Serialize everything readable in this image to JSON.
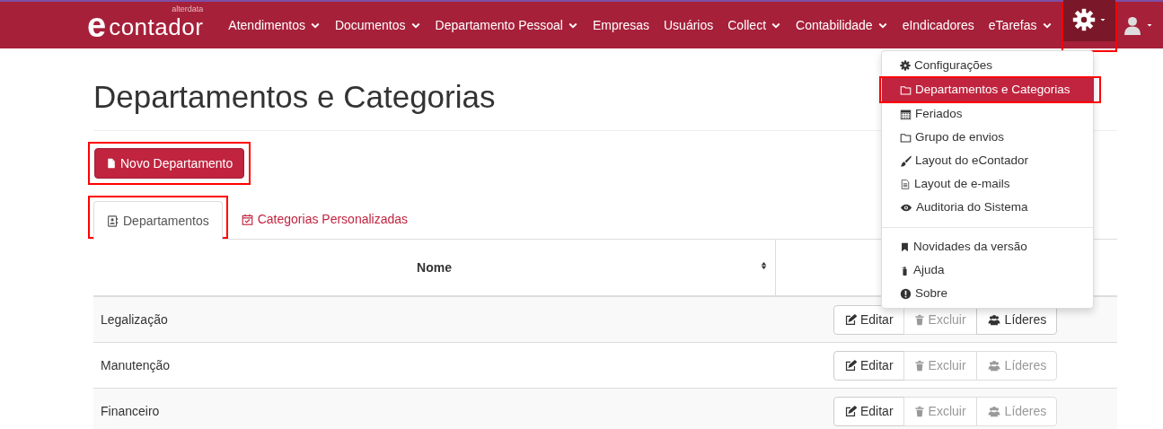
{
  "navbar": {
    "logo": {
      "mark": "e",
      "name": "contador",
      "brand": "alterdata"
    },
    "items": [
      {
        "label": "Atendimentos",
        "has_caret": true
      },
      {
        "label": "Documentos",
        "has_caret": true
      },
      {
        "label": "Departamento Pessoal",
        "has_caret": true
      },
      {
        "label": "Empresas",
        "has_caret": false
      },
      {
        "label": "Usuários",
        "has_caret": false
      },
      {
        "label": "Collect",
        "has_caret": true
      },
      {
        "label": "Contabilidade",
        "has_caret": true
      },
      {
        "label": "eIndicadores",
        "has_caret": false
      },
      {
        "label": "eTarefas",
        "has_caret": true
      }
    ],
    "settings": {
      "expanded": true,
      "highlighted": true
    }
  },
  "settings_menu": [
    {
      "kind": "item",
      "label": "Configurações",
      "selected": false,
      "highlighted": false
    },
    {
      "kind": "item",
      "label": "Departamentos e Categorias",
      "selected": true,
      "highlighted": true
    },
    {
      "kind": "item",
      "label": "Feriados",
      "selected": false,
      "highlighted": false
    },
    {
      "kind": "item",
      "label": "Grupo de envios",
      "selected": false,
      "highlighted": false
    },
    {
      "kind": "item",
      "label": "Layout do eContador",
      "selected": false,
      "highlighted": false
    },
    {
      "kind": "item",
      "label": "Layout de e-mails",
      "selected": false,
      "highlighted": false
    },
    {
      "kind": "item",
      "label": "Auditoria do Sistema",
      "selected": false,
      "highlighted": false
    },
    {
      "kind": "divider"
    },
    {
      "kind": "item",
      "label": "Novidades da versão",
      "selected": false,
      "highlighted": false
    },
    {
      "kind": "item",
      "label": "Ajuda",
      "selected": false,
      "highlighted": false
    },
    {
      "kind": "item",
      "label": "Sobre",
      "selected": false,
      "highlighted": false
    }
  ],
  "page": {
    "title": "Departamentos e Categorias",
    "new_button": {
      "label": "Novo Departamento",
      "highlighted": true
    },
    "tabs": [
      {
        "label": "Departamentos",
        "selected": true,
        "highlighted": true
      },
      {
        "label": "Categorias Personalizadas",
        "selected": false,
        "highlighted": false
      }
    ],
    "table": {
      "columns": [
        {
          "label": "Nome",
          "sortable": true
        }
      ],
      "rows": [
        {
          "name": "Legalização",
          "actions": [
            {
              "label": "Editar",
              "disabled": false
            },
            {
              "label": "Excluir",
              "disabled": true
            },
            {
              "label": "Líderes",
              "disabled": false
            }
          ]
        },
        {
          "name": "Manutenção",
          "actions": [
            {
              "label": "Editar",
              "disabled": false
            },
            {
              "label": "Excluir",
              "disabled": true
            },
            {
              "label": "Líderes",
              "disabled": true
            }
          ]
        },
        {
          "name": "Financeiro",
          "actions": [
            {
              "label": "Editar",
              "disabled": false
            },
            {
              "label": "Excluir",
              "disabled": true
            },
            {
              "label": "Líderes",
              "disabled": true
            }
          ]
        }
      ]
    }
  }
}
